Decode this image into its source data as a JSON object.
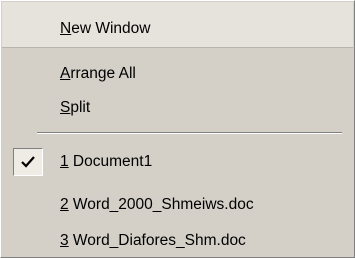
{
  "menu": {
    "items": [
      {
        "accel": "N",
        "rest": "ew Window"
      },
      {
        "accel": "A",
        "rest": "rrange All"
      },
      {
        "accel": "S",
        "rest": "plit"
      }
    ],
    "documents": [
      {
        "accel": "1",
        "rest": " Document1",
        "checked": true
      },
      {
        "accel": "2",
        "rest": " Word_2000_Shmeiws.doc",
        "checked": false
      },
      {
        "accel": "3",
        "rest": " Word_Diafores_Shm.doc",
        "checked": false
      }
    ]
  },
  "icons": {
    "active_document": "checkmark-icon"
  }
}
